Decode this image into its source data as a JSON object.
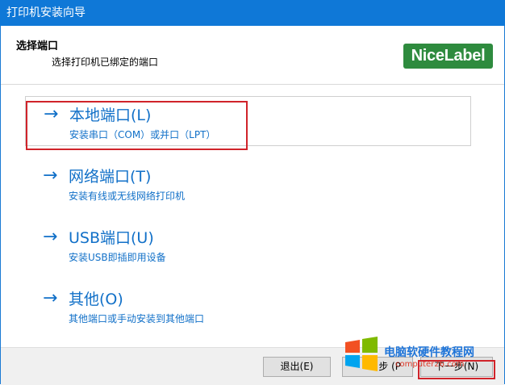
{
  "window": {
    "title": "打印机安装向导"
  },
  "header": {
    "title": "选择端口",
    "subtitle": "选择打印机已绑定的端口",
    "logo_text": "NiceLabel",
    "logo_color": "#2e8b3e"
  },
  "options": [
    {
      "arrow": "→",
      "title": "本地端口(L)",
      "desc": "安装串口（COM）或并口（LPT）",
      "selected": true
    },
    {
      "arrow": "→",
      "title": "网络端口(T)",
      "desc": "安装有线或无线网络打印机"
    },
    {
      "arrow": "→",
      "title": "USB端口(U)",
      "desc": "安装USB即插即用设备"
    },
    {
      "arrow": "→",
      "title": "其他(O)",
      "desc": "其他端口或手动安装到其他端口"
    }
  ],
  "footer": {
    "exit_label": "退出(E)",
    "back_label": "步 (P",
    "next_label": "下一步(N)"
  },
  "watermark": {
    "text": "电脑软硬件教程网",
    "url": "computer26.com"
  },
  "colors": {
    "titlebar": "#0f78d7",
    "link": "#1170c8",
    "highlight": "#d0232a"
  }
}
